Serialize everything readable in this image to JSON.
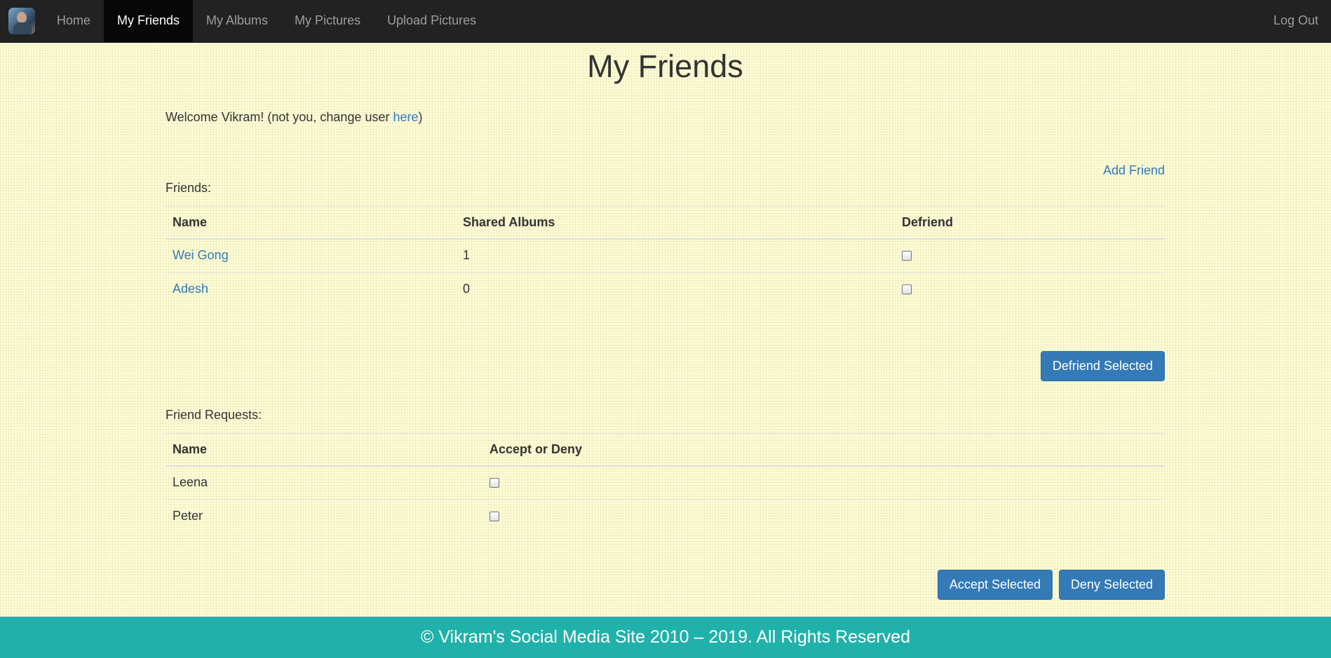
{
  "nav": {
    "items": [
      {
        "label": "Home",
        "active": false
      },
      {
        "label": "My Friends",
        "active": true
      },
      {
        "label": "My Albums",
        "active": false
      },
      {
        "label": "My Pictures",
        "active": false
      },
      {
        "label": "Upload Pictures",
        "active": false
      }
    ],
    "logout_label": "Log Out"
  },
  "page": {
    "title": "My Friends",
    "welcome_prefix": "Welcome Vikram! (not you, change user ",
    "welcome_link": "here",
    "welcome_suffix": ")",
    "add_friend_label": "Add Friend"
  },
  "friends": {
    "label": "Friends:",
    "columns": [
      "Name",
      "Shared Albums",
      "Defriend"
    ],
    "rows": [
      {
        "name": "Wei Gong",
        "shared_albums": "1",
        "defriend": false
      },
      {
        "name": "Adesh",
        "shared_albums": "0",
        "defriend": false
      }
    ],
    "defriend_button": "Defriend Selected"
  },
  "requests": {
    "label": "Friend Requests:",
    "columns": [
      "Name",
      "Accept or Deny"
    ],
    "rows": [
      {
        "name": "Leena",
        "selected": false
      },
      {
        "name": "Peter",
        "selected": false
      }
    ],
    "accept_button": "Accept Selected",
    "deny_button": "Deny Selected"
  },
  "footer": {
    "text": "© Vikram's Social Media Site 2010 – 2019. All Rights Reserved"
  },
  "colors": {
    "navbar": "#222222",
    "active_nav": "#080808",
    "link": "#337ab7",
    "button": "#337ab7",
    "footer": "#20b2aa",
    "page_background": "#fffdd6"
  }
}
